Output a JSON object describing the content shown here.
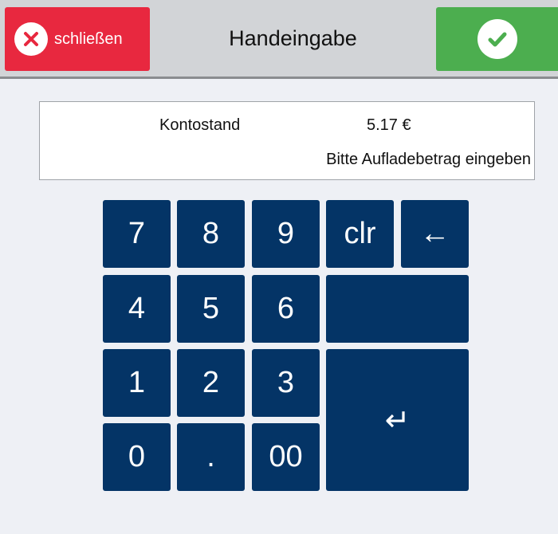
{
  "header": {
    "close_label": "schließen",
    "title": "Handeingabe"
  },
  "info": {
    "balance_label": "Kontostand",
    "balance_value": "5.17 €",
    "hint": "Bitte Aufladebetrag eingeben"
  },
  "keypad": {
    "k7": "7",
    "k8": "8",
    "k9": "9",
    "clear": "clr",
    "backspace": "←",
    "k4": "4",
    "k5": "5",
    "k6": "6",
    "blank": "",
    "k1": "1",
    "k2": "2",
    "k3": "3",
    "enter": "↵",
    "k0": "0",
    "dot": ".",
    "k00": "00"
  },
  "colors": {
    "close": "#e8283f",
    "confirm": "#4cae4f",
    "key": "#043466",
    "background": "#eef0f5"
  },
  "icons": {
    "close": "close-x-icon",
    "confirm": "checkmark-icon"
  }
}
